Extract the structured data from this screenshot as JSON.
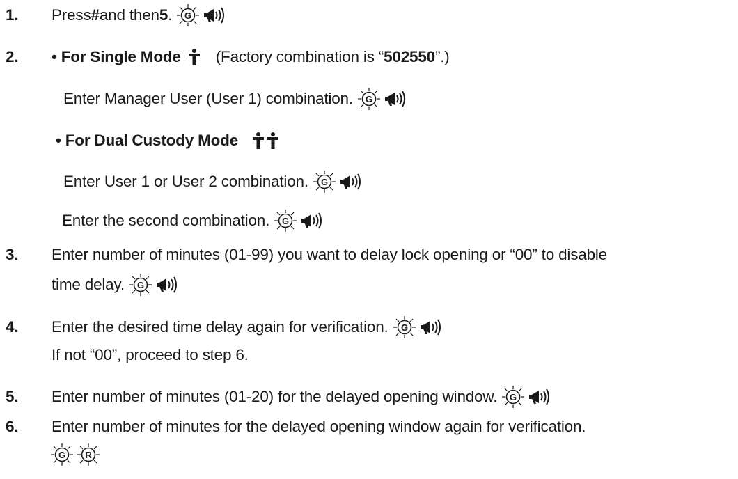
{
  "steps": {
    "s1": {
      "num": "1.",
      "pre": "Press ",
      "hash": "#",
      "mid": " and then ",
      "five": "5",
      "post": "."
    },
    "s2": {
      "num": "2.",
      "single_title": "• For Single Mode",
      "paren_pre": "(Factory combination is “",
      "factory_code": "502550",
      "paren_post": "”.)",
      "single_text": "Enter Manager User (User 1) combination.",
      "dual_title": "• For Dual Custody Mode",
      "dual_text1": "Enter User 1 or User 2 combination.",
      "dual_text2": "Enter the second combination."
    },
    "s3": {
      "num": "3.",
      "line1": "Enter number of minutes (01-99) you want to delay lock opening or  “00” to disable",
      "line2": "time delay."
    },
    "s4": {
      "num": "4.",
      "line1": "Enter the desired time delay again for verification.",
      "line2": "If not “00”, proceed to step 6."
    },
    "s5": {
      "num": "5.",
      "text": "Enter number of minutes (01-20) for the delayed opening window."
    },
    "s6": {
      "num": "6.",
      "text": "Enter number of minutes for the delayed opening window again for verification."
    }
  },
  "icons": {
    "green_led": {
      "letter": "G",
      "name": "green-led-icon"
    },
    "red_led": {
      "letter": "R",
      "name": "red-led-icon"
    },
    "beep": "beep-horn-icon",
    "person": "person-icon"
  }
}
